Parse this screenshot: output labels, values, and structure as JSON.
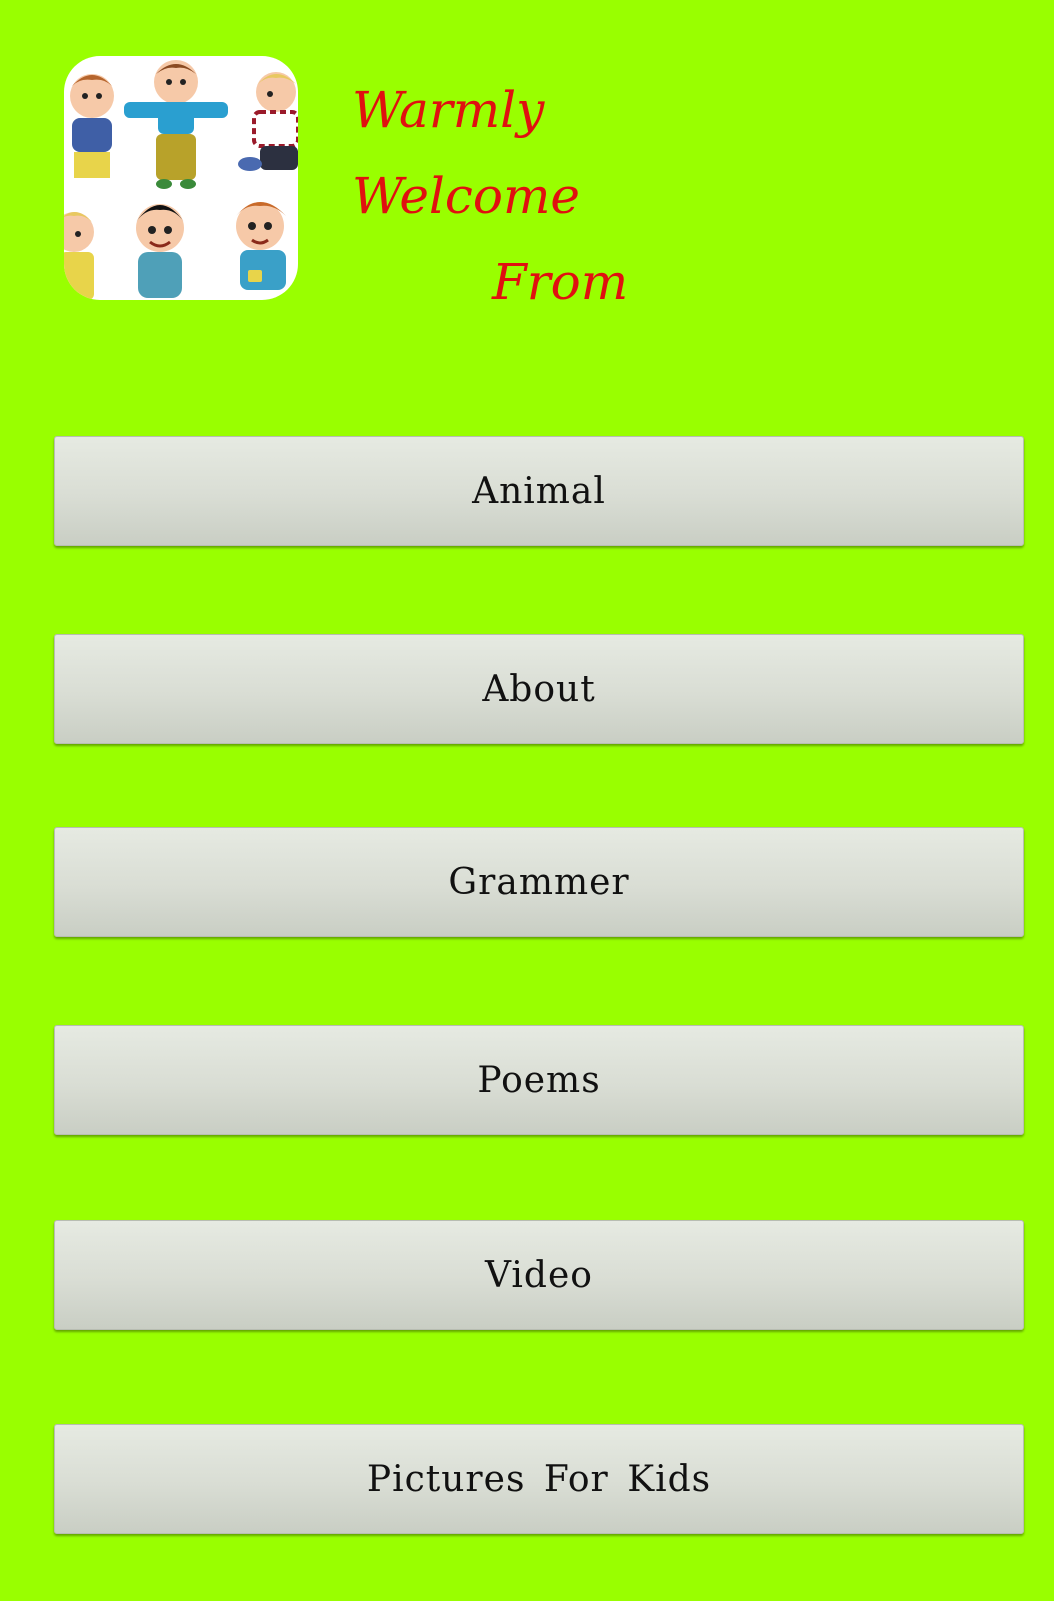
{
  "welcome": {
    "line1": "Warmly",
    "line2": "Welcome",
    "line3": "From"
  },
  "logo": {
    "icon": "cartoon-kids-logo"
  },
  "menu": {
    "animal": "Animal",
    "about": "About",
    "grammer": "Grammer",
    "poems": "Poems",
    "video": "Video",
    "pictures": "Pictures For Kids"
  },
  "colors": {
    "background": "#99ff00",
    "welcome_text": "#e01010",
    "button_text": "#111111"
  }
}
